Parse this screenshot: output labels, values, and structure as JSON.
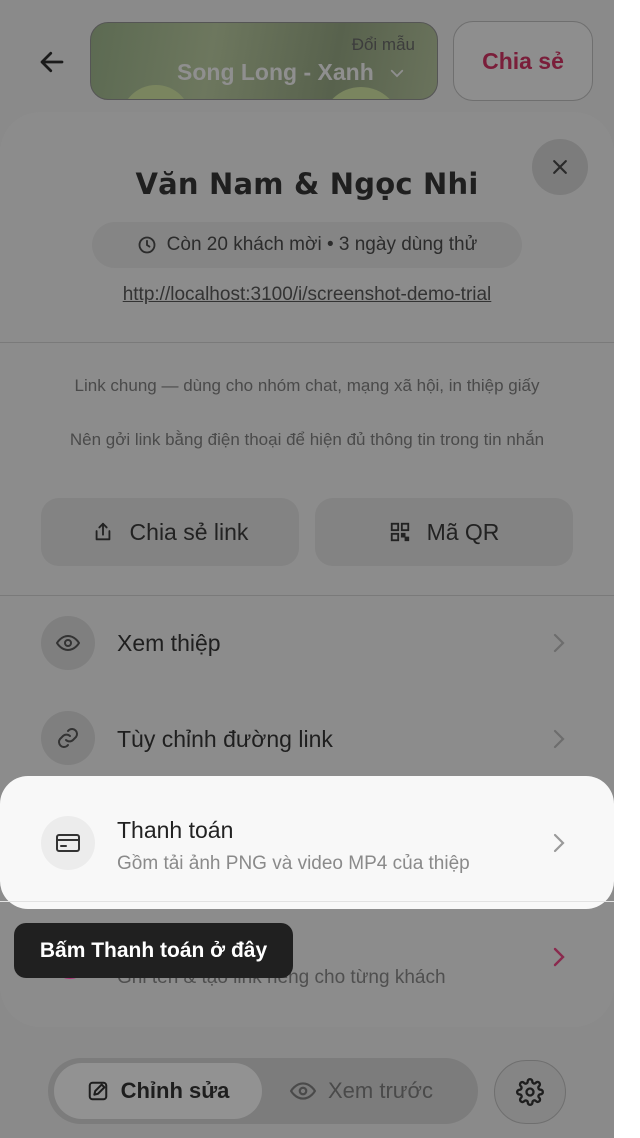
{
  "header": {
    "back_icon": "arrow-left-icon",
    "template_change_label": "Đổi mẫu",
    "template_name": "Song Long - Xanh",
    "share_label": "Chia sẻ"
  },
  "sheet": {
    "couple_name": "Văn Nam & Ngọc Nhi",
    "trial_status": "Còn 20 khách mời • 3 ngày dùng thử",
    "invite_url": "http://localhost:3100/i/screenshot-demo-trial",
    "note_line1": "Link chung — dùng cho nhóm chat, mạng xã hội, in thiệp giấy",
    "note_line2": "Nên gởi link bằng điện thoại để hiện đủ thông tin trong tin nhắn",
    "share_link_label": "Chia sẻ link",
    "qr_label": "Mã QR",
    "rows": [
      {
        "title": "Xem thiệp",
        "icon": "eye-icon"
      },
      {
        "title": "Tùy chỉnh đường link",
        "icon": "link-icon"
      },
      {
        "title": "Thanh toán",
        "subtitle": "Gồm tải ảnh PNG và video MP4 của thiệp",
        "icon": "credit-card-icon"
      },
      {
        "subtitle": "Ghi tên & tạo link riêng cho từng khách"
      }
    ]
  },
  "tooltip": "Bấm Thanh toán ở đây",
  "bottom_bar": {
    "edit_label": "Chỉnh sửa",
    "preview_label": "Xem trước"
  },
  "colors": {
    "accent": "#c2185b",
    "overlay": "#8c8c8c",
    "tooltip_bg": "#202020"
  }
}
